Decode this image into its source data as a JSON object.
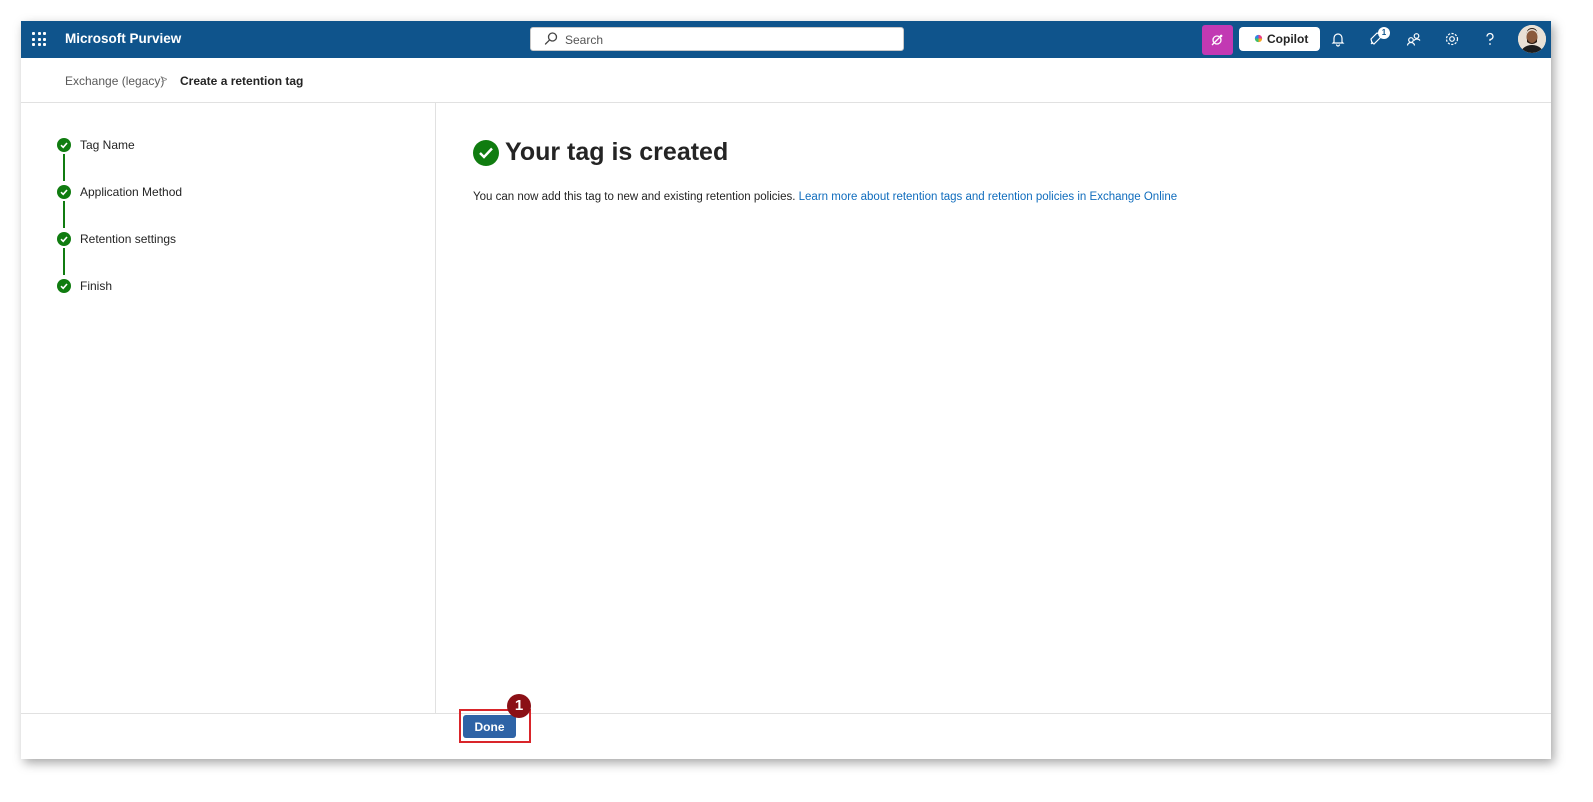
{
  "topbar": {
    "app_name": "Microsoft Purview",
    "search_placeholder": "Search",
    "copilot_label": "Copilot",
    "notification_badge": "1",
    "colors": {
      "bar": "#0f548c",
      "accent_purple": "#c239b3"
    },
    "icons": [
      "waffle-icon",
      "search-icon",
      "copilot-icon",
      "bell-icon",
      "rocket-icon",
      "people-icon",
      "gear-icon",
      "help-icon",
      "avatar"
    ]
  },
  "breadcrumb": {
    "items": [
      "Exchange (legacy)",
      "Create a retention tag"
    ],
    "separator": ">"
  },
  "steps": [
    {
      "label": "Tag Name",
      "status": "done"
    },
    {
      "label": "Application Method",
      "status": "done"
    },
    {
      "label": "Retention settings",
      "status": "done"
    },
    {
      "label": "Finish",
      "status": "done"
    }
  ],
  "main": {
    "title": "Your tag is created",
    "description": "You can now add this tag to new and existing retention policies.",
    "link_text": "Learn more about retention tags and retention policies in Exchange Online",
    "success_color": "#107c10"
  },
  "footer": {
    "done_label": "Done"
  },
  "annotation": {
    "callout_number": "1",
    "highlight_color": "#d9252a"
  }
}
